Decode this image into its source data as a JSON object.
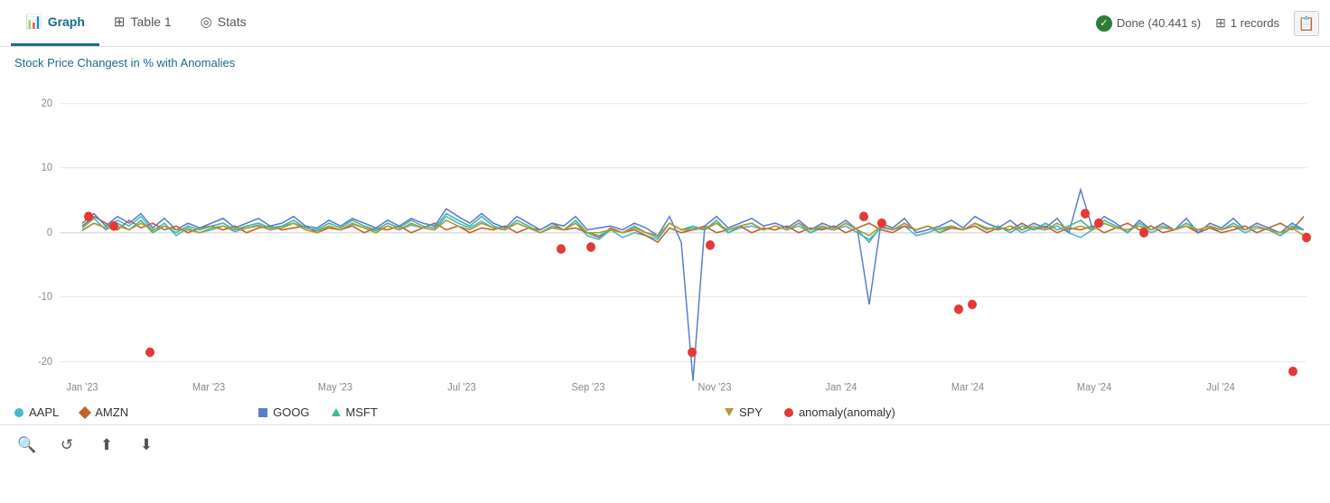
{
  "tabs": [
    {
      "id": "graph",
      "label": "Graph",
      "icon": "📊",
      "active": true
    },
    {
      "id": "table1",
      "label": "Table 1",
      "icon": "⊞",
      "active": false
    },
    {
      "id": "stats",
      "label": "Stats",
      "icon": "◎",
      "active": false
    }
  ],
  "status": {
    "done_label": "Done (40.441 s)",
    "records_label": "1 records"
  },
  "chart": {
    "title": "Stock Price Changest in % with Anomalies",
    "y_axis": {
      "max": 20,
      "mid_high": 10,
      "zero": 0,
      "mid_low": -10,
      "min": -20
    },
    "x_axis_labels": [
      "Jan '23",
      "Mar '23",
      "May '23",
      "Jul '23",
      "Sep '23",
      "Nov '23",
      "Jan '24",
      "Mar '24",
      "May '24",
      "Jul '24"
    ]
  },
  "legend": {
    "items": [
      {
        "id": "aapl",
        "label": "AAPL",
        "color": "#4db6d0",
        "shape": "circle"
      },
      {
        "id": "amzn",
        "label": "AMZN",
        "color": "#c0642a",
        "shape": "diamond"
      },
      {
        "id": "goog",
        "label": "GOOG",
        "color": "#5b7fcc",
        "shape": "square"
      },
      {
        "id": "msft",
        "label": "MSFT",
        "color": "#3db8a0",
        "shape": "triangle"
      },
      {
        "id": "spy",
        "label": "SPY",
        "color": "#b8962e",
        "shape": "triangle-down"
      },
      {
        "id": "anomaly",
        "label": "anomaly(anomaly)",
        "color": "#e53935",
        "shape": "circle"
      }
    ]
  },
  "toolbar": {
    "buttons": [
      {
        "id": "search",
        "icon": "🔍",
        "label": "Search"
      },
      {
        "id": "refresh",
        "icon": "↺",
        "label": "Refresh"
      },
      {
        "id": "upload",
        "icon": "↑",
        "label": "Upload"
      },
      {
        "id": "download",
        "icon": "↓",
        "label": "Download"
      }
    ]
  }
}
